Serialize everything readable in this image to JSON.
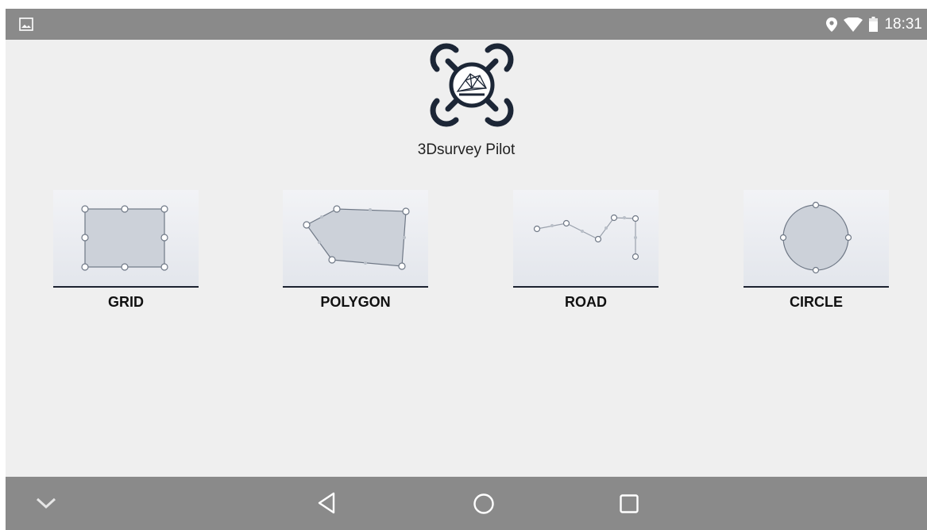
{
  "status_bar": {
    "time": "18:31",
    "left_icon": "gallery-notification-icon",
    "icons": [
      "location-icon",
      "wifi-icon",
      "battery-icon"
    ]
  },
  "app": {
    "title": "3Dsurvey Pilot",
    "logo": "drone-logo"
  },
  "modes": [
    {
      "label": "GRID",
      "icon": "grid-rectangle-icon"
    },
    {
      "label": "POLYGON",
      "icon": "polygon-shape-icon"
    },
    {
      "label": "ROAD",
      "icon": "road-polyline-icon"
    },
    {
      "label": "CIRCLE",
      "icon": "circle-shape-icon"
    }
  ],
  "nav_bar": {
    "buttons": [
      "hide-keyboard-icon",
      "back-icon",
      "home-icon",
      "recents-icon"
    ]
  },
  "colors": {
    "bars": "#8a8a8a",
    "background": "#efefef",
    "shape_fill": "#ccd1d9",
    "underline": "#1c2230"
  }
}
